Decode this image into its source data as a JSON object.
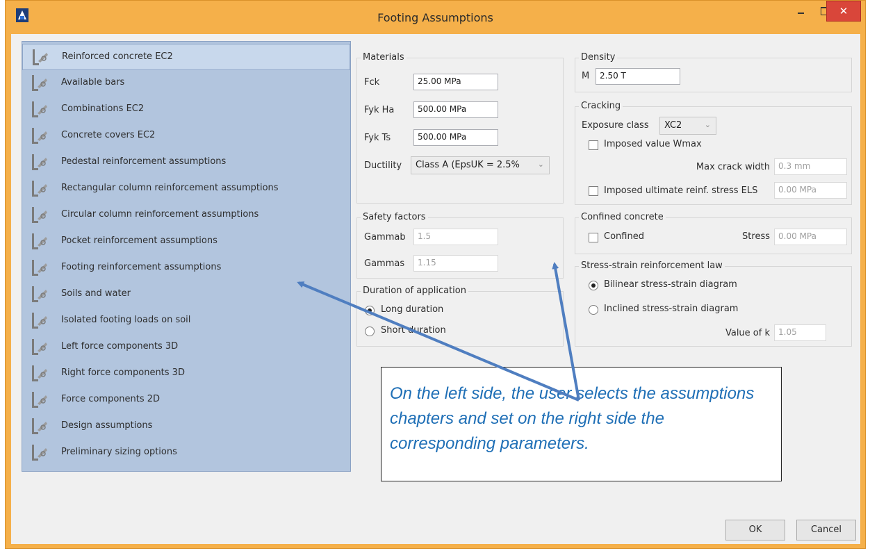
{
  "window": {
    "title": "Footing Assumptions",
    "app_icon": "app-icon"
  },
  "nav_items": [
    "Reinforced concrete EC2",
    "Available bars",
    "Combinations EC2",
    "Concrete covers EC2",
    "Pedestal reinforcement assumptions",
    "Rectangular column reinforcement assumptions",
    "Circular column reinforcement assumptions",
    "Pocket reinforcement assumptions",
    "Footing reinforcement assumptions",
    "Soils and water",
    "Isolated footing loads on soil",
    "Left force components 3D",
    "Right force components 3D",
    "Force components 2D",
    "Design assumptions",
    "Preliminary sizing options"
  ],
  "materials": {
    "title": "Materials",
    "fck_label": "Fck",
    "fck_value": "25.00 MPa",
    "fyk_ha_label": "Fyk Ha",
    "fyk_ha_value": "500.00 MPa",
    "fyk_ts_label": "Fyk Ts",
    "fyk_ts_value": "500.00 MPa",
    "ductility_label": "Ductility",
    "ductility_value": "Class A (EpsUK = 2.5%"
  },
  "density": {
    "title": "Density",
    "m_label": "M",
    "m_value": "2.50 T"
  },
  "cracking": {
    "title": "Cracking",
    "exposure_label": "Exposure class",
    "exposure_value": "XC2",
    "imposed_wmax_label": "Imposed value Wmax",
    "imposed_wmax_checked": false,
    "max_crack_label": "Max crack width",
    "max_crack_value": "0.3 mm",
    "imposed_stress_label": "Imposed ultimate reinf. stress ELS",
    "imposed_stress_checked": false,
    "imposed_stress_value": "0.00 MPa"
  },
  "safety": {
    "title": "Safety factors",
    "gammab_label": "Gammab",
    "gammab_value": "1.5",
    "gammas_label": "Gammas",
    "gammas_value": "1.15"
  },
  "confined": {
    "title": "Confined concrete",
    "confined_label": "Confined",
    "confined_checked": false,
    "stress_label": "Stress",
    "stress_value": "0.00 MPa"
  },
  "duration": {
    "title": "Duration of application",
    "long_label": "Long duration",
    "short_label": "Short duration",
    "selected": "long"
  },
  "stress_strain": {
    "title": "Stress-strain reinforcement law",
    "bilinear_label": "Bilinear stress-strain diagram",
    "inclined_label": "Inclined stress-strain diagram",
    "selected": "bilinear",
    "k_label": "Value of k",
    "k_value": "1.05"
  },
  "buttons": {
    "ok": "OK",
    "cancel": "Cancel"
  },
  "callout": {
    "text": "On the left side, the user selects the assumptions chapters and set on the right side the corresponding parameters."
  },
  "colors": {
    "frame": "#f5b04a",
    "close": "#d9463a",
    "nav_bg": "#b2c5de",
    "arrow": "#4f7ec0",
    "callout_text": "#1f6fb6"
  }
}
